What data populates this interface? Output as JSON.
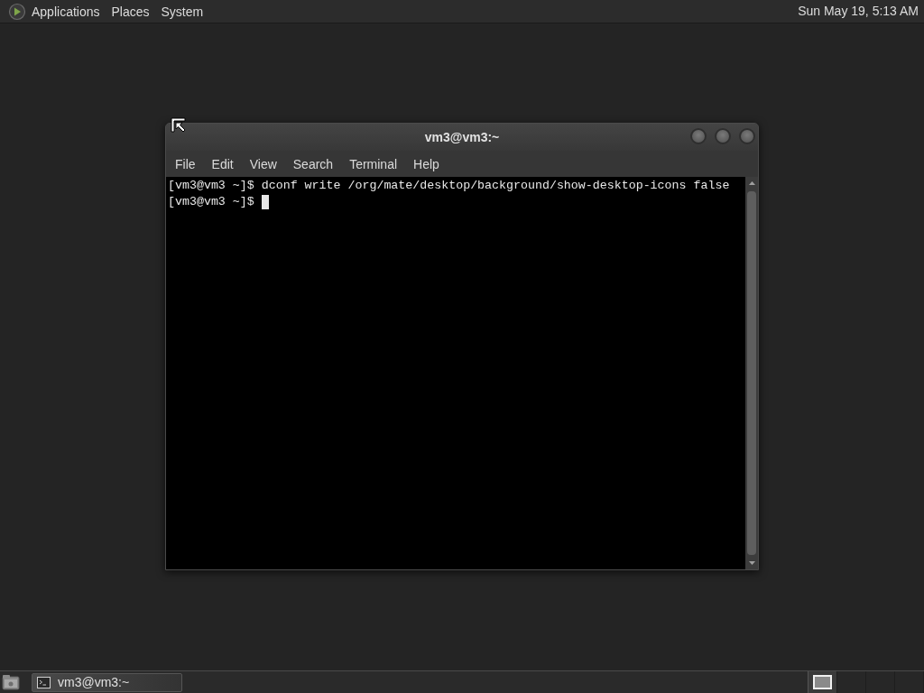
{
  "top_panel": {
    "menus": [
      "Applications",
      "Places",
      "System"
    ],
    "clock": "Sun May 19, 5:13 AM"
  },
  "window": {
    "title": "vm3@vm3:~",
    "menu": [
      "File",
      "Edit",
      "View",
      "Search",
      "Terminal",
      "Help"
    ],
    "terminal_lines": [
      {
        "text": "[vm3@vm3 ~]$ dconf write /org/mate/desktop/background/show-desktop-icons false",
        "cursor": false
      },
      {
        "text": "[vm3@vm3 ~]$",
        "cursor": true
      }
    ]
  },
  "bottom_panel": {
    "tasks": [
      {
        "label": "vm3@vm3:~"
      }
    ],
    "workspaces": [
      {
        "selected": true,
        "has_window": true
      },
      {
        "selected": false,
        "has_window": false
      },
      {
        "selected": false,
        "has_window": false
      },
      {
        "selected": false,
        "has_window": false
      }
    ]
  }
}
